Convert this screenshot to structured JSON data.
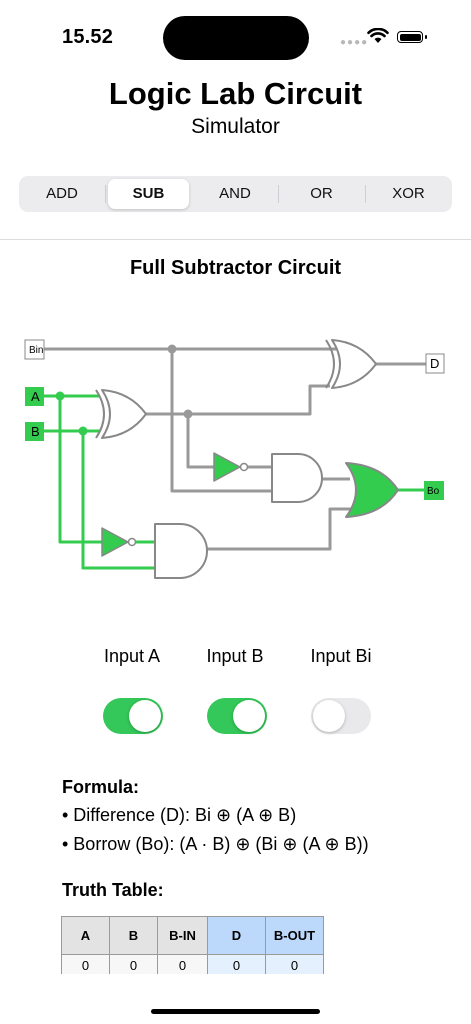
{
  "status_bar": {
    "time": "15.52"
  },
  "header": {
    "title": "Logic Lab Circuit",
    "subtitle": "Simulator"
  },
  "tabs": [
    {
      "label": "ADD",
      "active": false
    },
    {
      "label": "SUB",
      "active": true
    },
    {
      "label": "AND",
      "active": false
    },
    {
      "label": "OR",
      "active": false
    },
    {
      "label": "XOR",
      "active": false
    }
  ],
  "circuit": {
    "title": "Full Subtractor Circuit",
    "labels": {
      "bin": "Bin",
      "a": "A",
      "b": "B",
      "d": "D",
      "bo": "Bo"
    },
    "colors": {
      "active": "#33cc4e",
      "inactive": "#999999",
      "gate_outline": "#888888"
    }
  },
  "inputs": [
    {
      "label": "Input A",
      "on": true
    },
    {
      "label": "Input B",
      "on": true
    },
    {
      "label": "Input Bi",
      "on": false
    }
  ],
  "formula": {
    "title": "Formula:",
    "lines": [
      "• Difference (D): Bi ⊕ (A ⊕ B)",
      "• Borrow (Bo): (A · B) ⊕ (Bi ⊕ (A ⊕ B))"
    ]
  },
  "truth_table": {
    "title": "Truth Table:",
    "headers": [
      "A",
      "B",
      "B-IN",
      "D",
      "B-OUT"
    ],
    "rows": [
      [
        "0",
        "0",
        "0",
        "0",
        "0"
      ]
    ]
  },
  "colors": {
    "accent": "#34c759",
    "toggle_off": "#e9e9eb",
    "output_header": "#bcd9fb"
  }
}
